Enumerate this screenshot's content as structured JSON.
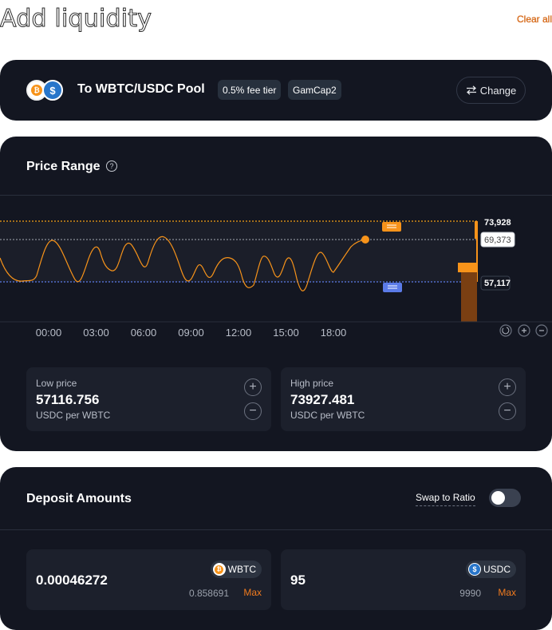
{
  "header": {
    "title": "Add liquidity",
    "clear_all": "Clear all"
  },
  "pool": {
    "title": "To WBTC/USDC Pool",
    "fee_tier": "0.5% fee tier",
    "strategy": "GamCap2",
    "change_label": "Change",
    "tokens": [
      "WBTC",
      "USDC"
    ]
  },
  "price_range": {
    "title": "Price Range",
    "upper_label": "73,928",
    "current_label": "69,373",
    "lower_label": "57,117",
    "time_ticks": [
      "00:00",
      "03:00",
      "06:00",
      "09:00",
      "12:00",
      "15:00",
      "18:00"
    ],
    "low": {
      "label": "Low price",
      "value": "57116.756",
      "unit": "USDC per WBTC"
    },
    "high": {
      "label": "High price",
      "value": "73927.481",
      "unit": "USDC per WBTC"
    }
  },
  "deposit": {
    "title": "Deposit Amounts",
    "swap_to_ratio": "Swap to Ratio",
    "swap_enabled": false,
    "token_a": {
      "amount": "0.00046272",
      "symbol": "WBTC",
      "balance": "0.858691",
      "max": "Max"
    },
    "token_b": {
      "amount": "95",
      "symbol": "USDC",
      "balance": "9990",
      "max": "Max"
    }
  },
  "colors": {
    "accent": "#f7931a",
    "lower_line": "#5b7be8",
    "card_bg": "#131621"
  },
  "chart_data": {
    "type": "line",
    "x": [
      "00:00",
      "03:00",
      "06:00",
      "09:00",
      "12:00",
      "15:00",
      "18:00"
    ],
    "upper_price": 73928,
    "current_price": 69373,
    "lower_price": 57117
  }
}
